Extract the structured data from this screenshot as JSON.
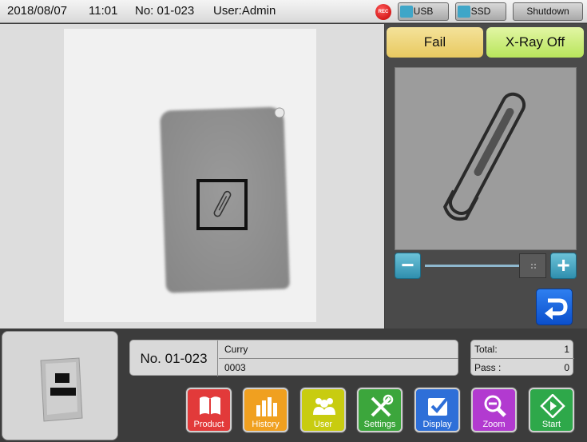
{
  "header": {
    "date": "2018/08/07",
    "time": "11:01",
    "number": "No: 01-023",
    "user": "User:Admin",
    "rec_label": "REC",
    "usb_label": "USB",
    "ssd_label": "SSD",
    "shutdown_label": "Shutdown"
  },
  "status": {
    "result_label": "Fail",
    "xray_label": "X-Ray Off"
  },
  "zoom": {
    "minus_label": "−",
    "plus_label": "+"
  },
  "product": {
    "number": "No. 01-023",
    "name": "Curry",
    "code": "0003"
  },
  "counts": {
    "total_label": "Total:",
    "total_value": "1",
    "pass_label": "Pass :",
    "pass_value": "0"
  },
  "nav": [
    {
      "label": "Product",
      "color": "#e23a3a"
    },
    {
      "label": "History",
      "color": "#f0a020"
    },
    {
      "label": "User",
      "color": "#c8cc10"
    },
    {
      "label": "Settings",
      "color": "#3ca63c"
    },
    {
      "label": "Display",
      "color": "#2e6fd8"
    },
    {
      "label": "Zoom",
      "color": "#b23ad0"
    },
    {
      "label": "Start",
      "color": "#2ea84a"
    }
  ]
}
